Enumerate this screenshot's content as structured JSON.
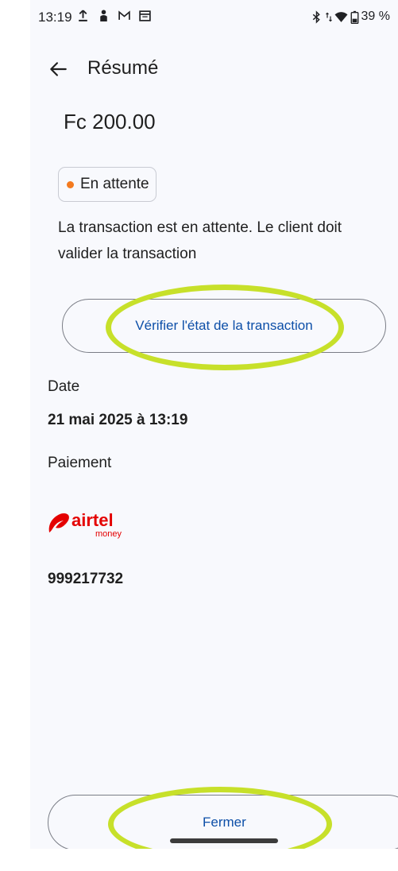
{
  "status_bar": {
    "time": "13:19",
    "battery": "39 %",
    "icons": [
      "upload-icon",
      "person-icon",
      "gmail-icon",
      "calendar-icon",
      "bluetooth-icon",
      "data-arrows-icon",
      "wifi-icon",
      "battery-icon"
    ]
  },
  "header": {
    "title": "Résumé",
    "back_icon": "arrow-left-icon"
  },
  "transaction": {
    "amount": "Fc 200.00",
    "status_label": "En attente",
    "status_color": "#f47a1f",
    "message": "La transaction est en attente. Le client doit valider la transaction",
    "check_button_label": "Vérifier l'état de la transaction"
  },
  "details": {
    "date_label": "Date",
    "date_value": "21 mai 2025 à 13:19",
    "payment_label": "Paiement",
    "payment_logo_brand": "airtel",
    "payment_logo_sub": "money",
    "phone": "999217732"
  },
  "footer": {
    "close_label": "Fermer"
  },
  "colors": {
    "accent": "#0d4fa8",
    "highlight": "#c7e02a",
    "airtel_red": "#e40000"
  }
}
